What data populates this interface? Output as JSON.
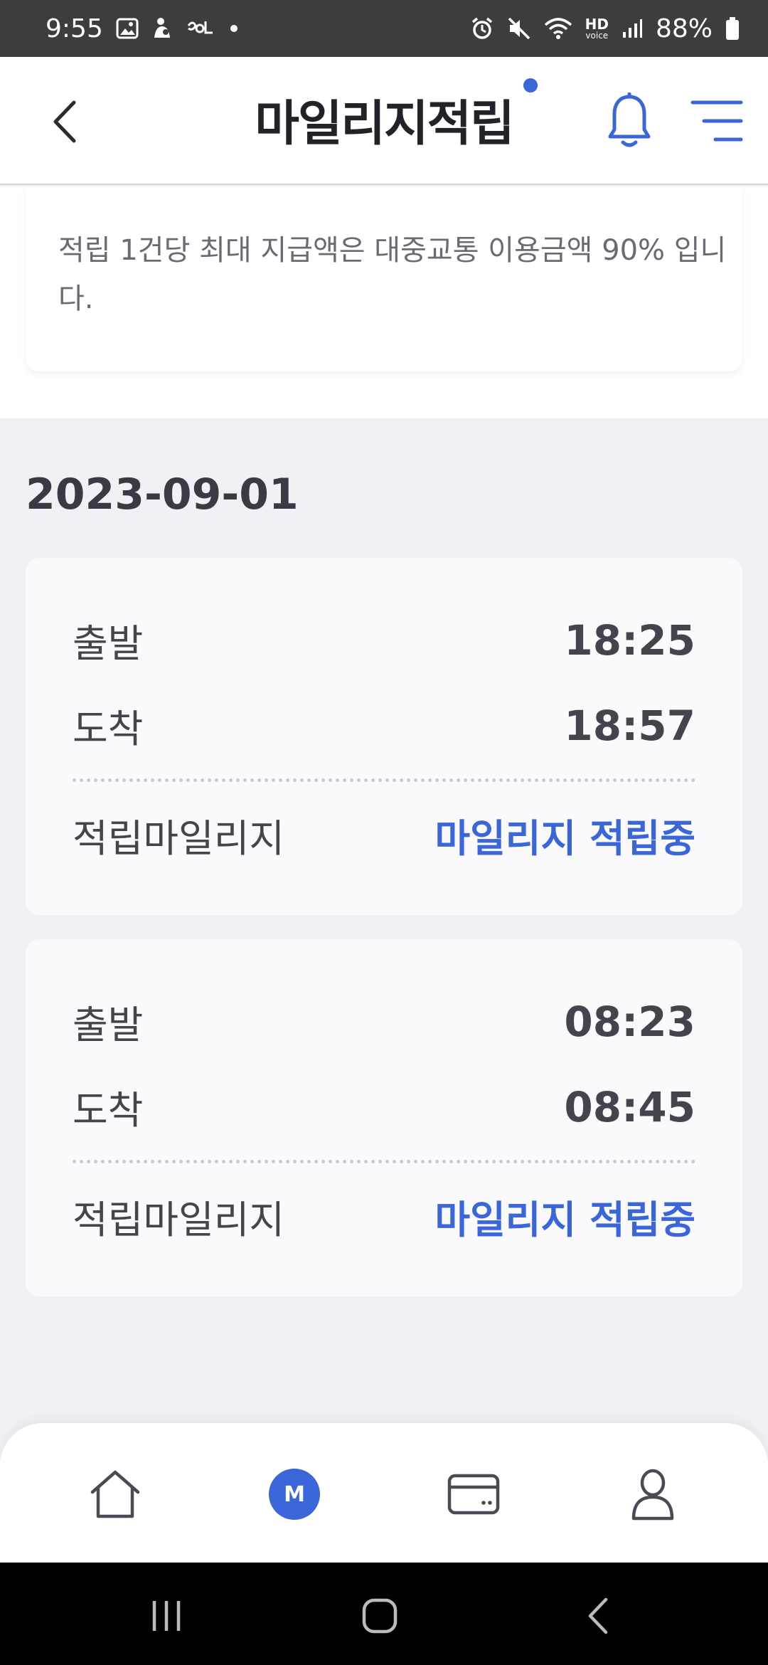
{
  "status_bar": {
    "time": "9:55",
    "battery": "88%",
    "left_icons": [
      "gallery-icon",
      "notification-app-icon",
      "sol-icon",
      "dot-icon"
    ],
    "right_icons": [
      "alarm-icon",
      "mute-icon",
      "wifi-icon",
      "hd-voice-icon",
      "signal-icon",
      "battery-icon"
    ],
    "hd_label": "HD",
    "voice_label": "voice"
  },
  "header": {
    "title": "마일리지적립",
    "accent_color": "#3a66d9"
  },
  "notice": {
    "text": "적립 1건당 최대 지급액은 대중교통 이용금액 90% 입니다."
  },
  "history": {
    "date": "2023-09-01",
    "trips": [
      {
        "departure_label": "출발",
        "departure_time": "18:25",
        "arrival_label": "도착",
        "arrival_time": "18:57",
        "mileage_label": "적립마일리지",
        "mileage_status": "마일리지 적립중"
      },
      {
        "departure_label": "출발",
        "departure_time": "08:23",
        "arrival_label": "도착",
        "arrival_time": "08:45",
        "mileage_label": "적립마일리지",
        "mileage_status": "마일리지 적립중"
      }
    ]
  },
  "bottom_nav": {
    "items": [
      {
        "icon": "home-icon"
      },
      {
        "icon": "mileage-icon",
        "label": "M",
        "active": true
      },
      {
        "icon": "card-icon"
      },
      {
        "icon": "profile-icon"
      }
    ]
  },
  "system_nav": {
    "buttons": [
      "recent-apps-icon",
      "home-circle-icon",
      "system-back-icon"
    ]
  }
}
